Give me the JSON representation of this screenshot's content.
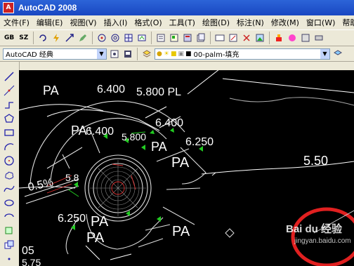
{
  "titlebar": {
    "title": "AutoCAD 2008",
    "icon": "autocad-icon"
  },
  "menu": [
    "文件(F)",
    "编辑(E)",
    "视图(V)",
    "插入(I)",
    "格式(O)",
    "工具(T)",
    "绘图(D)",
    "标注(N)",
    "修改(M)",
    "窗口(W)",
    "帮助"
  ],
  "toolbar1": {
    "gb_label": "GB",
    "sz_label": "SZ"
  },
  "toolbar2": {
    "workspace": "AutoCAD 经典",
    "layer": "00-palm-填充"
  },
  "drawing": {
    "labels": [
      "PA",
      "6.400",
      "5.800 PL",
      "PA",
      "6.400",
      "PA",
      "6.400",
      "5.800",
      "PA",
      "6.250",
      "PA",
      "5.50",
      "0.5%",
      "5.8",
      "6.250",
      "PA",
      "PA",
      "05",
      "5.75"
    ]
  },
  "watermark": {
    "brand": "Bai du 经验",
    "url": "jingyan.baidu.com"
  },
  "colors": {
    "titlebar": "#1947c2",
    "canvas": "#000000",
    "drawing_green": "#22cc22",
    "annotation": "#ffffff",
    "circle_mark": "#e02020"
  }
}
